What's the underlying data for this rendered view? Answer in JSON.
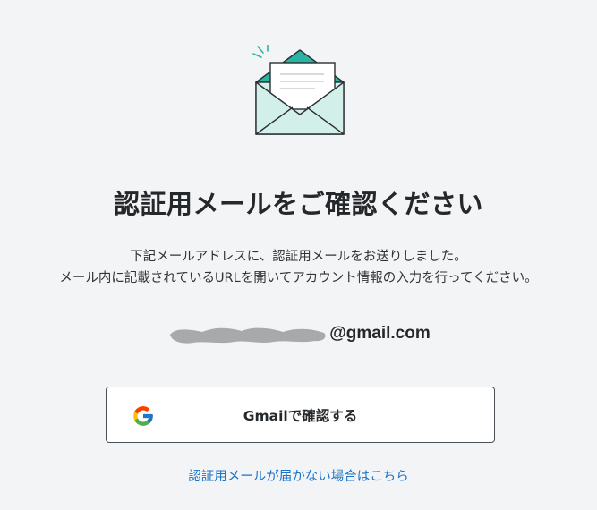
{
  "icon": "envelope-open-icon",
  "heading": "認証用メールをご確認ください",
  "description": {
    "line1": "下記メールアドレスに、認証用メールをお送りしました。",
    "line2": "メール内に記載されているURLを開いてアカウント情報の入力を行ってください。"
  },
  "email": {
    "domain": "@gmail.com"
  },
  "gmail_button": {
    "label": "Gmailで確認する",
    "icon": "google-g-icon"
  },
  "help_link": {
    "label": "認証用メールが届かない場合はこちら"
  },
  "colors": {
    "background": "#f3f4f6",
    "accent_teal": "#2bb3a3",
    "envelope_fill": "#d3efe9",
    "link": "#1a73c8",
    "heading": "#25282b"
  }
}
